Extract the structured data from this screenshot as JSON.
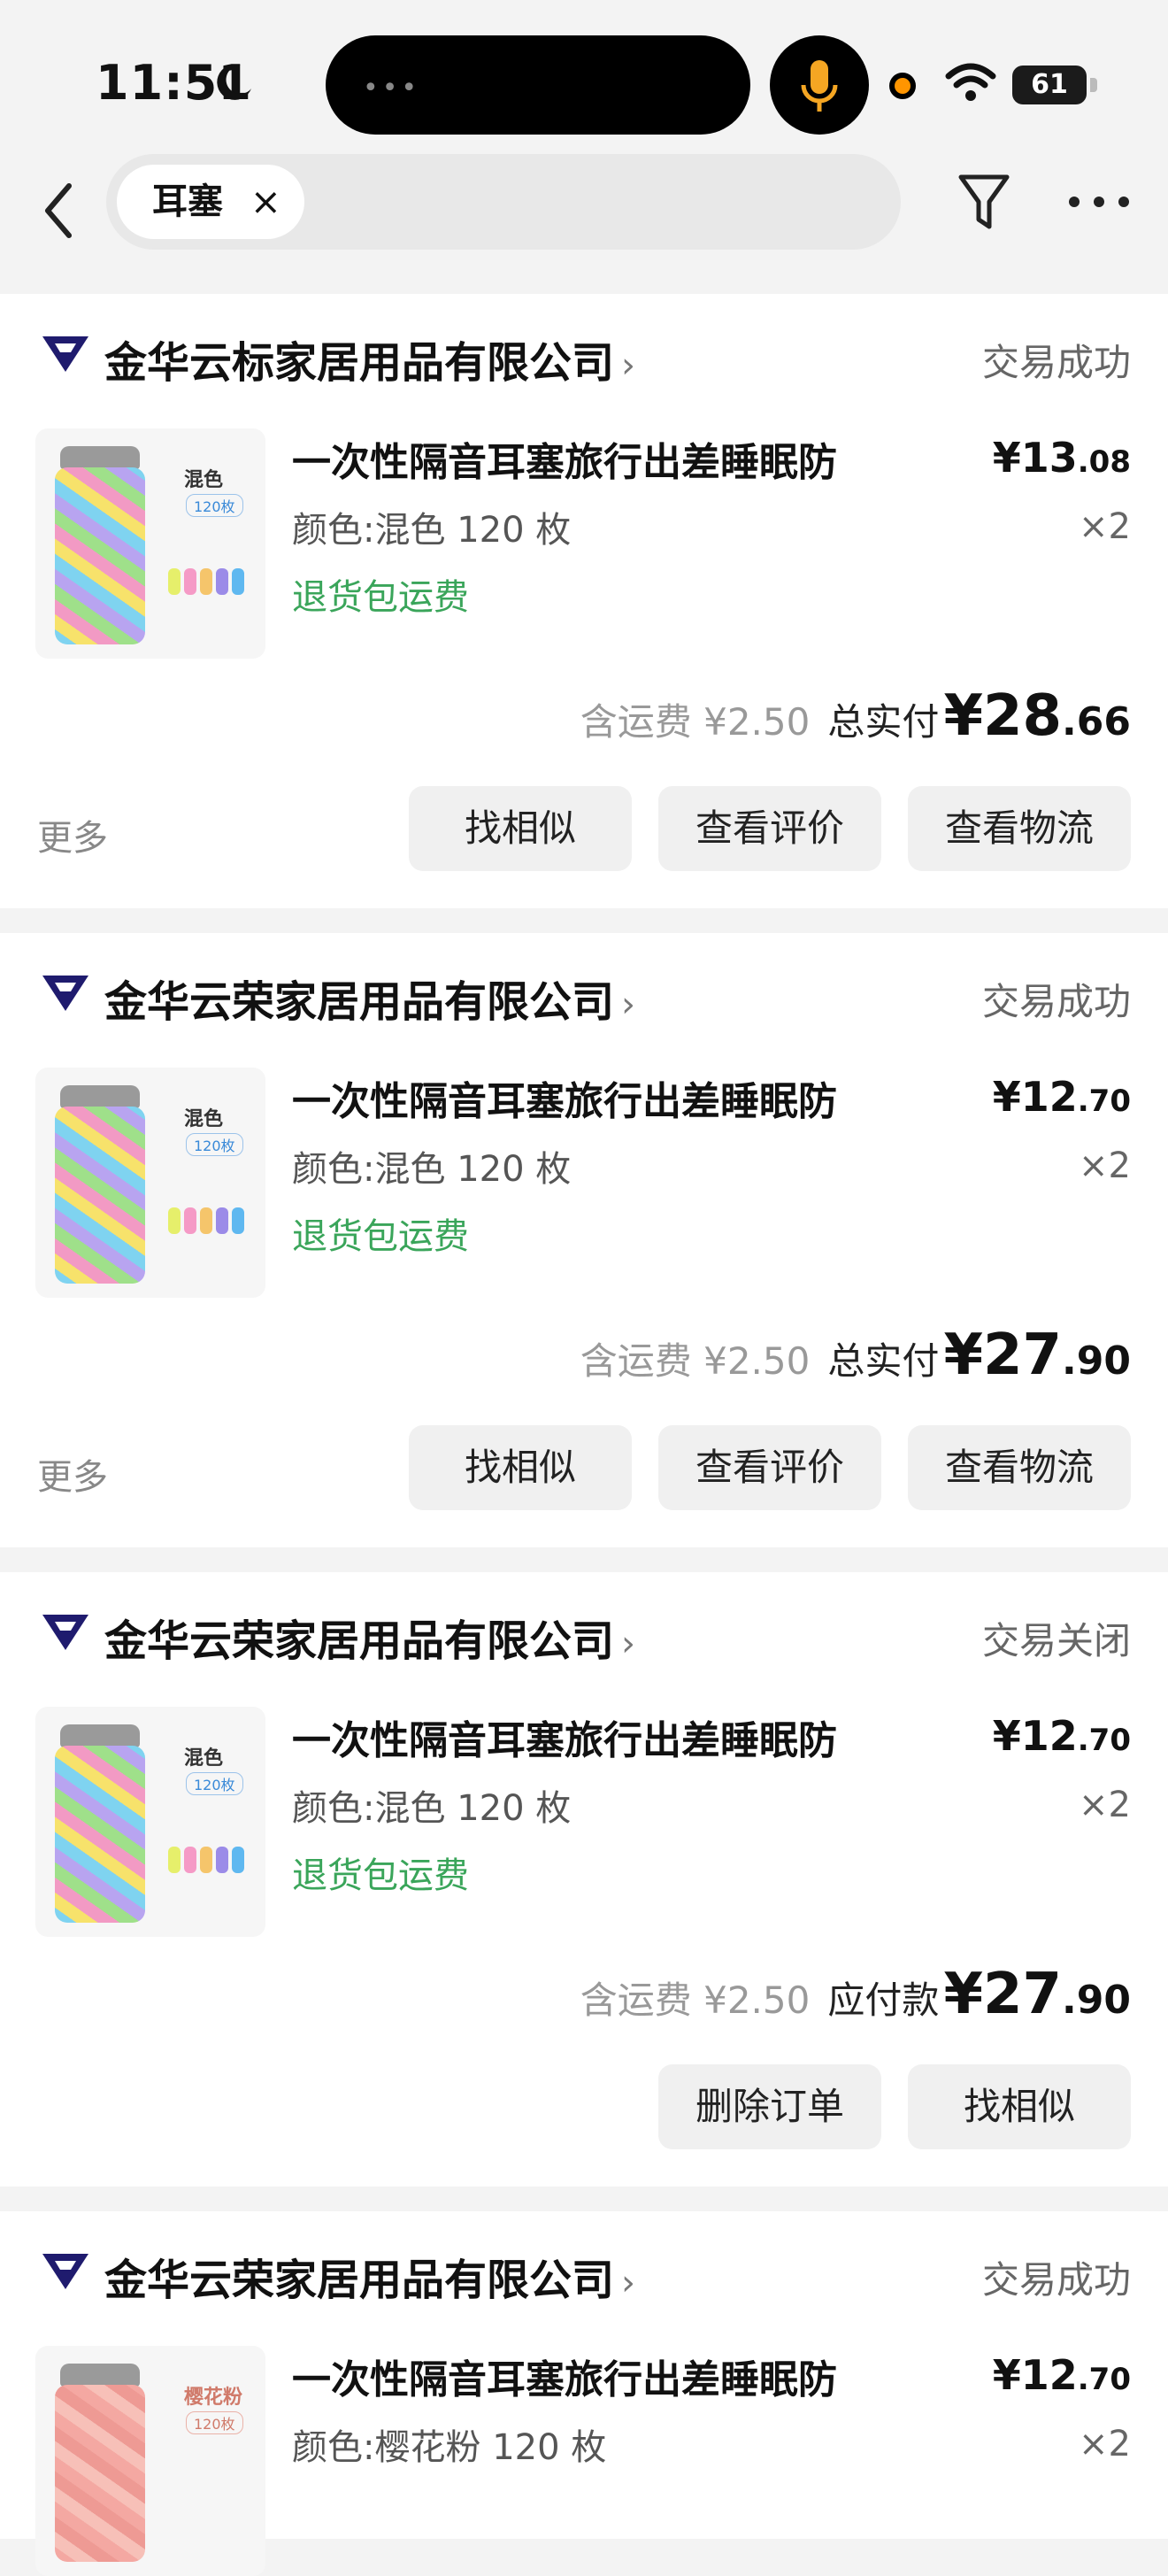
{
  "status_bar": {
    "time": "11:51",
    "battery": "61"
  },
  "search": {
    "chip_label": "耳塞",
    "chip_close": "×"
  },
  "orders": [
    {
      "shop": "金华云标家居用品有限公司",
      "status": "交易成功",
      "title": "一次性隔音耳塞旅行出差睡眠防",
      "spec": "颜色:混色 120 枚",
      "return_note": "退货包运费",
      "price_int": "¥13",
      "price_dec": ".08",
      "qty": "×2",
      "shipping": "含运费 ¥2.50",
      "total_label": "总实付",
      "total_int": "¥28",
      "total_dec": ".66",
      "thumb_label": "混色",
      "thumb_sub": "120枚",
      "more": "更多",
      "buttons": [
        "找相似",
        "查看评价",
        "查看物流"
      ]
    },
    {
      "shop": "金华云荣家居用品有限公司",
      "status": "交易成功",
      "title": "一次性隔音耳塞旅行出差睡眠防",
      "spec": "颜色:混色 120 枚",
      "return_note": "退货包运费",
      "price_int": "¥12",
      "price_dec": ".70",
      "qty": "×2",
      "shipping": "含运费 ¥2.50",
      "total_label": "总实付",
      "total_int": "¥27",
      "total_dec": ".90",
      "thumb_label": "混色",
      "thumb_sub": "120枚",
      "more": "更多",
      "buttons": [
        "找相似",
        "查看评价",
        "查看物流"
      ]
    },
    {
      "shop": "金华云荣家居用品有限公司",
      "status": "交易关闭",
      "title": "一次性隔音耳塞旅行出差睡眠防",
      "spec": "颜色:混色 120 枚",
      "return_note": "退货包运费",
      "price_int": "¥12",
      "price_dec": ".70",
      "qty": "×2",
      "shipping": "含运费 ¥2.50",
      "total_label": "应付款",
      "total_int": "¥27",
      "total_dec": ".90",
      "thumb_label": "混色",
      "thumb_sub": "120枚",
      "buttons": [
        "删除订单",
        "找相似"
      ]
    },
    {
      "shop": "金华云荣家居用品有限公司",
      "status": "交易成功",
      "title": "一次性隔音耳塞旅行出差睡眠防",
      "spec": "颜色:樱花粉 120 枚",
      "price_int": "¥12",
      "price_dec": ".70",
      "qty": "×2",
      "thumb_label": "樱花粉",
      "thumb_sub": "120枚"
    }
  ],
  "colors": {
    "accent_green": "#3aa55a",
    "brand_logo": "#1f1b6e",
    "page_bg": "#f3f3f3"
  }
}
